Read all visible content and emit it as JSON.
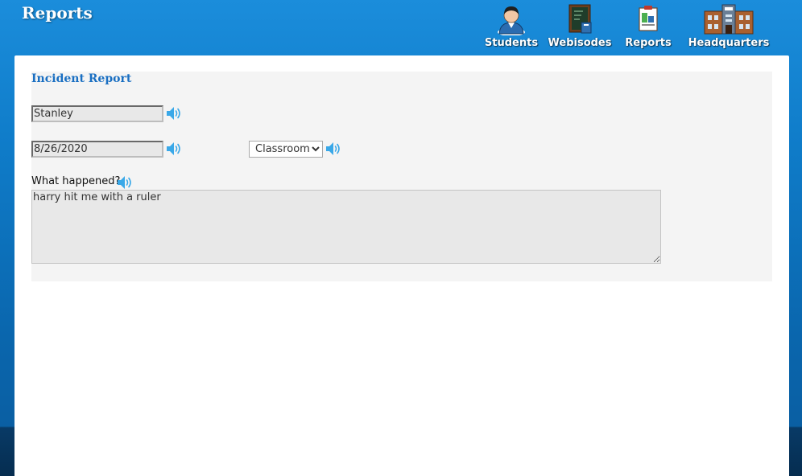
{
  "app": {
    "title": "Reports"
  },
  "nav": [
    {
      "label": "Students",
      "icon": "students-icon"
    },
    {
      "label": "Webisodes",
      "icon": "webisodes-icon"
    },
    {
      "label": "Reports",
      "icon": "reports-icon"
    },
    {
      "label": "Headquarters",
      "icon": "headquarters-icon"
    }
  ],
  "form": {
    "title": "Incident Report",
    "name_value": "Stanley",
    "date_value": "8/26/2020",
    "location_selected": "Classroom",
    "question": "What happened?",
    "description_value": "harry hit me with a ruler"
  },
  "colors": {
    "header_blue": "#1b8ddb",
    "title_blue": "#1a6fc2",
    "speaker_blue": "#3aa8e8",
    "form_bg": "#f4f4f4",
    "input_bg": "#e8e8e8"
  }
}
